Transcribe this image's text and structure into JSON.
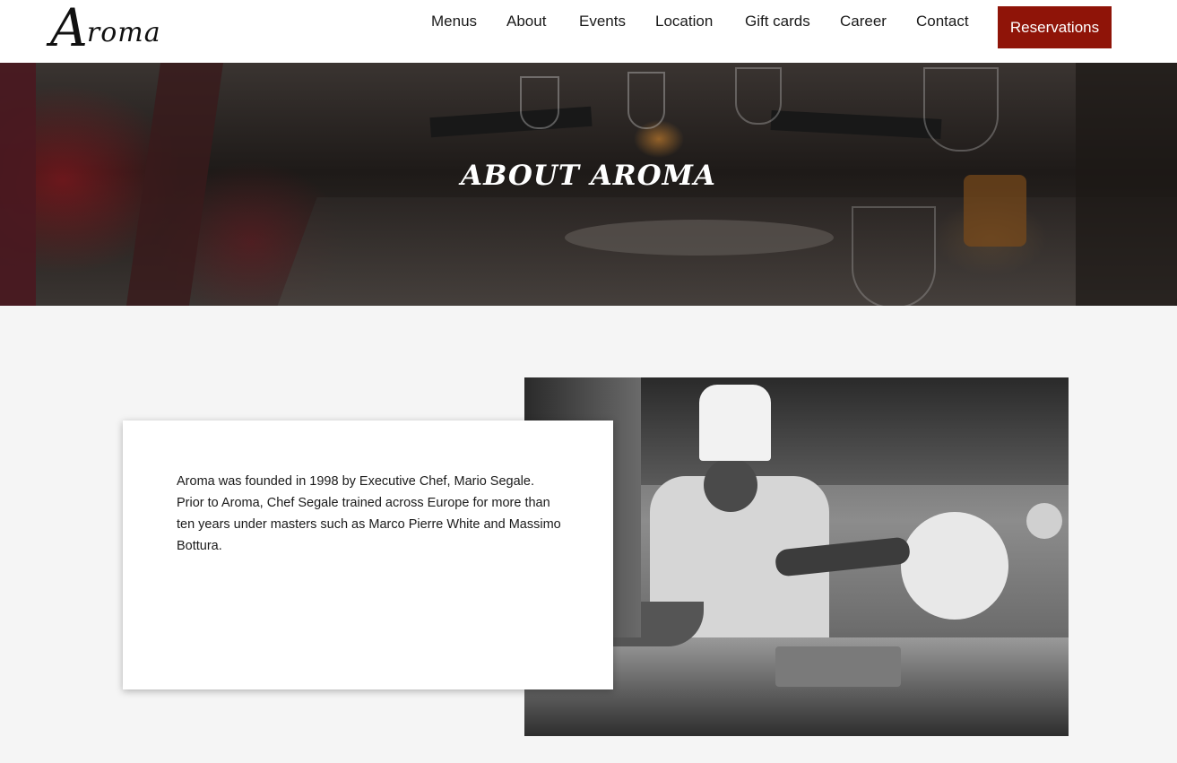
{
  "header": {
    "logo_cap": "A",
    "logo_rest": "roma",
    "nav": [
      "Menus",
      "About",
      "Events",
      "Location",
      "Gift cards",
      "Career",
      "Contact"
    ],
    "reserve_label": "Reservations",
    "accent_color": "#8f1408"
  },
  "hero": {
    "title": "ABOUT AROMA"
  },
  "about": {
    "text": "Aroma was founded in 1998 by Executive Chef, Mario Segale. Prior to Aroma, Chef Segale trained across Europe for more than ten years under masters such as Marco Pierre White and Massimo Bottura."
  }
}
